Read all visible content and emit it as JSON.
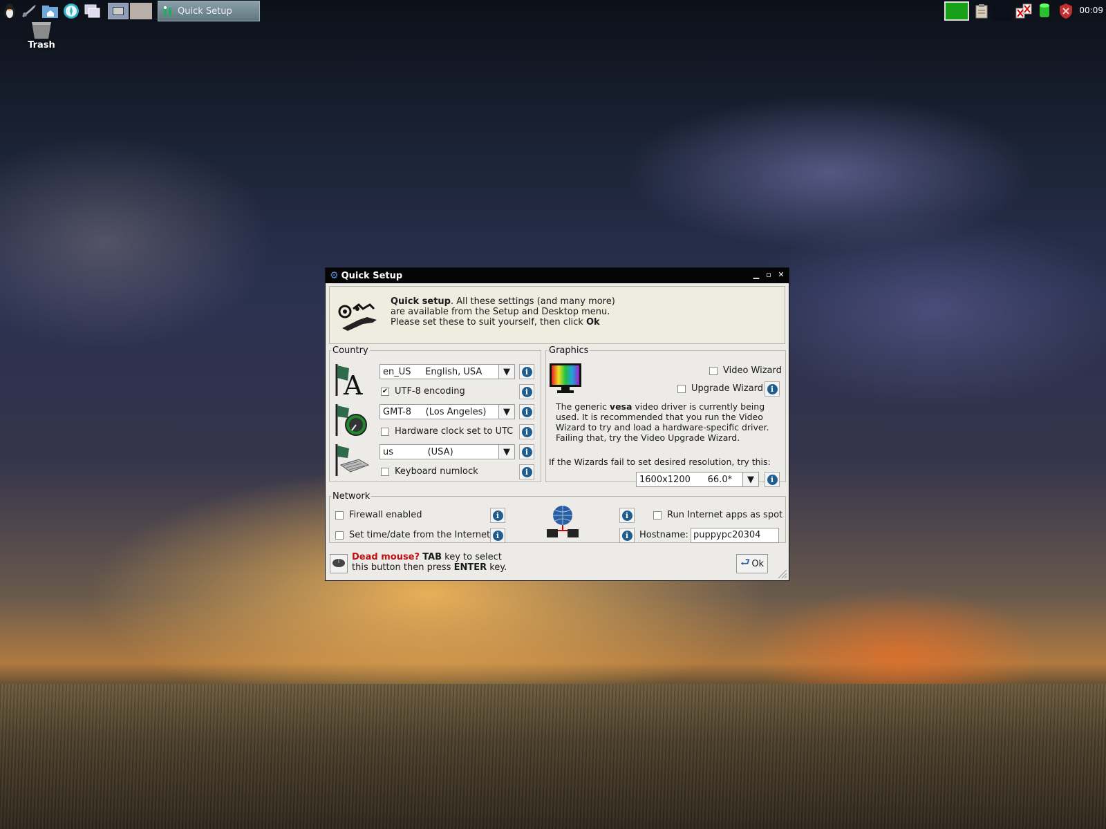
{
  "desktop": {
    "trash_label": "Trash"
  },
  "taskbar": {
    "task_title": "Quick Setup",
    "clock": "00:09"
  },
  "window": {
    "title": "Quick Setup",
    "banner": {
      "line1_bold": "Quick setup",
      "line1_rest": ". All these settings (and many more)",
      "line2": "are available from the Setup and Desktop menu.",
      "line3_start": "Please set these to suit yourself, then click ",
      "line3_bold": "Ok"
    },
    "country": {
      "legend": "Country",
      "locale_value": "en_US     English, USA",
      "utf8_label": "UTF-8 encoding",
      "utf8_checked": true,
      "timezone_value": "GMT-8     (Los Angeles)",
      "hwclock_label": "Hardware clock set to UTC",
      "keyboard_value": "us            (USA)",
      "numlock_label": "Keyboard numlock"
    },
    "graphics": {
      "legend": "Graphics",
      "video_wizard_label": "Video Wizard",
      "upgrade_wizard_label": "Upgrade Wizard",
      "desc_start": "The generic ",
      "desc_bold": "vesa",
      "desc_rest": " video driver is currently being used. It is recommended that you run the Video Wizard to try and load a hardware-specific driver. Failing that, try the Video Upgrade Wizard.",
      "fallback_text": "If the Wizards fail to set desired resolution, try this:",
      "resolution_value": "1600x1200      66.0*"
    },
    "network": {
      "legend": "Network",
      "firewall_label": "Firewall enabled",
      "timedate_label": "Set time/date from the Internet",
      "spot_label": "Run Internet apps as spot",
      "hostname_label": "Hostname:",
      "hostname_value": "puppypc20304"
    },
    "footer": {
      "dead_mouse": "Dead mouse?",
      "tab": "TAB",
      "text1": " key to select",
      "text2_start": "this button then press ",
      "enter": "ENTER",
      "text2_end": " key.",
      "ok_label": "Ok"
    }
  },
  "colors": {
    "dead_mouse": "#c01010",
    "info_icon": "#1f5d8f",
    "titlebar": "#050505"
  }
}
